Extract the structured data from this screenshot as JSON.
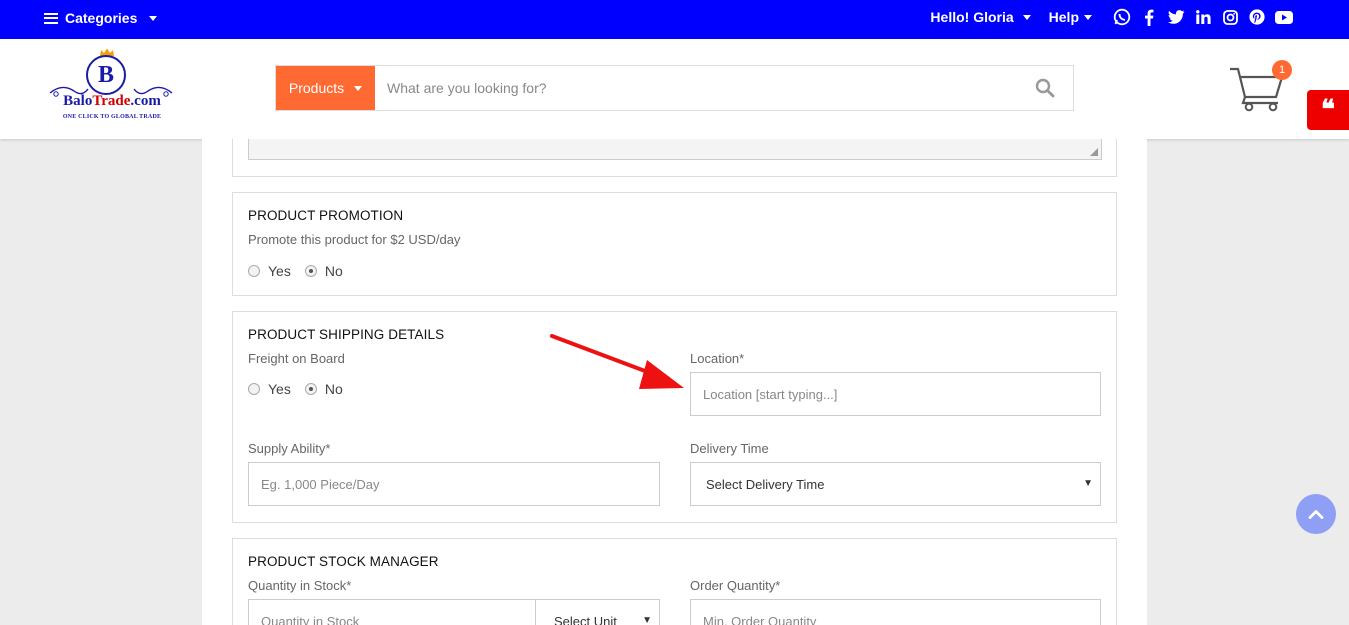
{
  "topbar": {
    "categories_label": "Categories",
    "greeting": "Hello! Gloria",
    "help_label": "Help",
    "social_icons": [
      "whatsapp-icon",
      "facebook-icon",
      "twitter-icon",
      "linkedin-icon",
      "instagram-icon",
      "pinterest-icon",
      "youtube-icon"
    ],
    "bg_color": "#0000ff"
  },
  "header": {
    "logo": {
      "letter": "B",
      "name_part1": "Balo",
      "name_part2": "Trade",
      "name_part3": ".com",
      "tagline": "ONE CLICK TO GLOBAL TRADE"
    },
    "search": {
      "category_label": "Products",
      "placeholder": "What are you looking for?"
    },
    "cart": {
      "count": "1"
    },
    "accent_color": "#ff6a33"
  },
  "sections": {
    "promotion": {
      "title": "PRODUCT PROMOTION",
      "subtitle": "Promote this product for $2 USD/day",
      "yes_label": "Yes",
      "no_label": "No",
      "selected": "No"
    },
    "shipping": {
      "title": "PRODUCT SHIPPING DETAILS",
      "fob_label": "Freight on Board",
      "yes_label": "Yes",
      "no_label": "No",
      "selected": "No",
      "location_label": "Location*",
      "location_placeholder": "Location [start typing...]",
      "supply_label": "Supply Ability*",
      "supply_placeholder": "Eg. 1,000 Piece/Day",
      "delivery_label": "Delivery Time",
      "delivery_value": "Select Delivery Time"
    },
    "stock": {
      "title": "PRODUCT STOCK MANAGER",
      "quantity_label": "Quantity in Stock*",
      "quantity_placeholder": "Quantity in Stock",
      "unit_value": "Select Unit",
      "order_label": "Order Quantity*",
      "order_placeholder": "Min. Order Quantity"
    }
  }
}
